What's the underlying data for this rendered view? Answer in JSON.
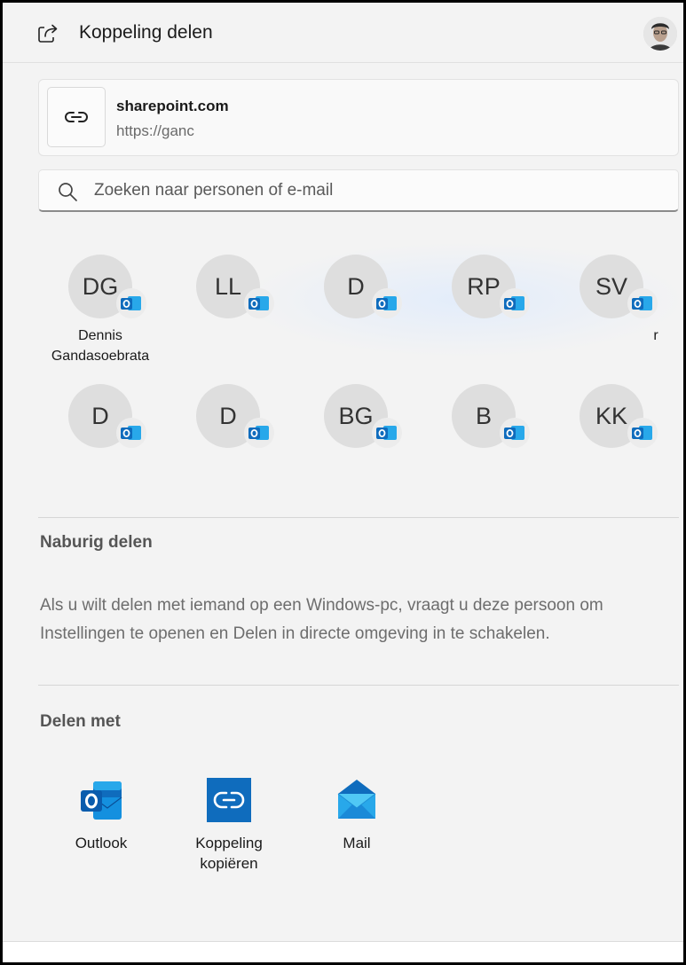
{
  "header": {
    "title": "Koppeling delen",
    "share_icon": "share-icon",
    "avatar": "user-avatar-photo"
  },
  "link": {
    "title": "sharepoint.com",
    "url": "https://ganc",
    "icon": "link-icon"
  },
  "search": {
    "placeholder": "Zoeken naar personen of e-mail",
    "value": "",
    "icon": "search-icon"
  },
  "contacts": [
    {
      "initials": "DG",
      "name": "Dennis Gandasoebrata"
    },
    {
      "initials": "LL",
      "name": ""
    },
    {
      "initials": "D",
      "name": ""
    },
    {
      "initials": "RP",
      "name": ""
    },
    {
      "initials": "SV",
      "name": "r"
    },
    {
      "initials": "D",
      "name": ""
    },
    {
      "initials": "D",
      "name": ""
    },
    {
      "initials": "BG",
      "name": ""
    },
    {
      "initials": "B",
      "name": ""
    },
    {
      "initials": "KK",
      "name": ""
    }
  ],
  "nearby": {
    "title": "Naburig delen",
    "text": "Als u wilt delen met iemand op een Windows-pc, vraagt u deze persoon om Instellingen te openen en Delen in directe omgeving in te schakelen."
  },
  "share_with": {
    "title": "Delen met",
    "apps": [
      {
        "label": "Outlook",
        "icon": "outlook-icon"
      },
      {
        "label": "Koppeling kopiëren",
        "icon": "copy-link-icon"
      },
      {
        "label": "Mail",
        "icon": "mail-icon"
      }
    ]
  },
  "colors": {
    "outlook_blue": "#0f6cbd",
    "accent": "#0078d4",
    "background": "#f3f3f3"
  }
}
